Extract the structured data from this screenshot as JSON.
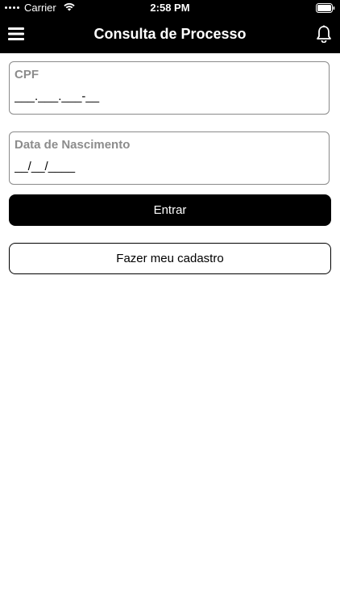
{
  "status_bar": {
    "carrier": "Carrier",
    "time": "2:58 PM"
  },
  "nav": {
    "title": "Consulta de Processo"
  },
  "form": {
    "cpf": {
      "label": "CPF",
      "placeholder": "___.___.___-__",
      "value": ""
    },
    "birth_date": {
      "label": "Data de Nascimento",
      "placeholder": "__/__/____",
      "value": ""
    }
  },
  "buttons": {
    "login_label": "Entrar",
    "register_label": "Fazer meu cadastro"
  },
  "icons": {
    "menu": "menu-icon",
    "notifications": "bell-icon",
    "wifi": "wifi-icon",
    "battery": "battery-icon"
  },
  "colors": {
    "bar_background": "#000000",
    "primary_button": "#000000",
    "label_gray": "#8c8c8c",
    "field_border": "#8a8a8a"
  }
}
